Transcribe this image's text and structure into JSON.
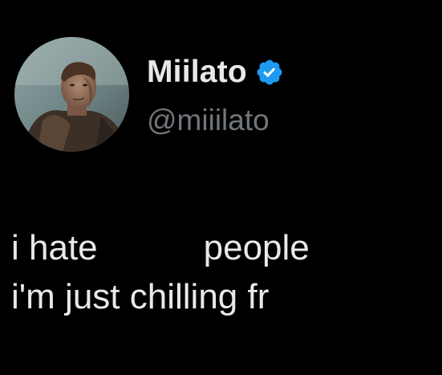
{
  "user": {
    "display_name": "Miilato",
    "handle": "@miiilato",
    "verified_icon": "verified-badge-icon",
    "avatar": "profile-photo"
  },
  "tweet": {
    "line1_part1": "i hate",
    "line1_part2": "people",
    "line2": "i'm just chilling fr"
  },
  "colors": {
    "background": "#000000",
    "text": "#e7e9ea",
    "handle": "#71767b",
    "verified": "#1d9bf0"
  }
}
